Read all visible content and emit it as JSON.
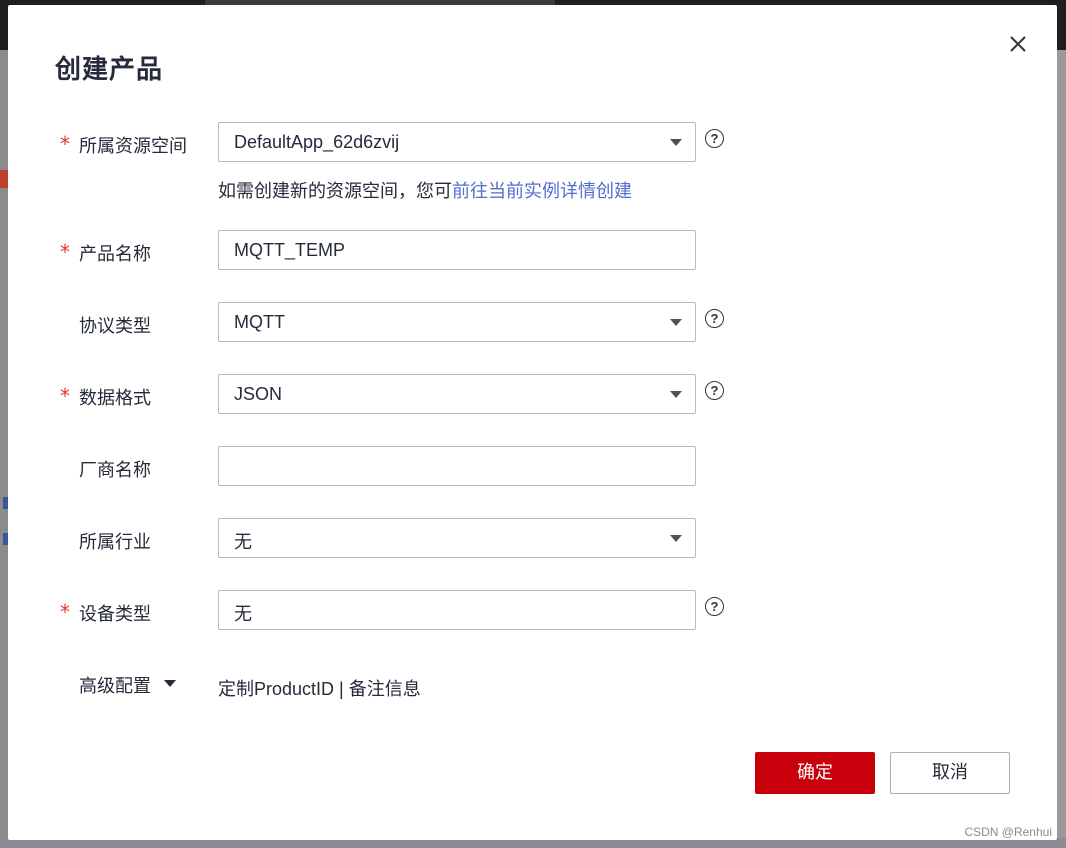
{
  "dialog": {
    "title": "创建产品",
    "close_icon": "close-icon"
  },
  "form": {
    "required_mark": "*",
    "resource_space": {
      "label": "所属资源空间",
      "value": "DefaultApp_62d6zvij",
      "hint_text": "如需创建新的资源空间，您可",
      "hint_link": "前往当前实例详情创建"
    },
    "product_name": {
      "label": "产品名称",
      "value": "MQTT_TEMP"
    },
    "protocol": {
      "label": "协议类型",
      "value": "MQTT"
    },
    "data_format": {
      "label": "数据格式",
      "value": "JSON"
    },
    "vendor": {
      "label": "厂商名称",
      "value": ""
    },
    "industry": {
      "label": "所属行业",
      "value": "无"
    },
    "device_type": {
      "label": "设备类型",
      "value": "无"
    },
    "help_icon": "?",
    "advanced": {
      "label": "高级配置",
      "link1": "定制ProductID",
      "separator": " | ",
      "link2": "备注信息"
    }
  },
  "buttons": {
    "ok": "确定",
    "cancel": "取消"
  },
  "watermark": "CSDN @Renhui",
  "colors": {
    "primary": "#c7000b",
    "link": "#526ecc",
    "required": "#e0352e"
  }
}
